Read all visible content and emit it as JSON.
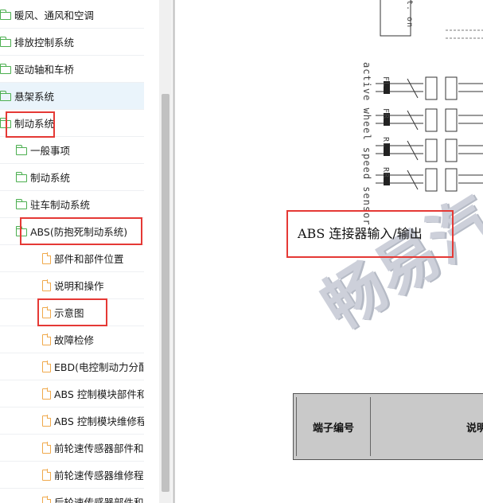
{
  "tree": {
    "items": [
      {
        "label": "暖风、通风和空调",
        "icon": "folder-icon",
        "level": 0
      },
      {
        "label": "排放控制系统",
        "icon": "folder-icon",
        "level": 0
      },
      {
        "label": "驱动轴和车桥",
        "icon": "folder-icon",
        "level": 0
      },
      {
        "label": "悬架系统",
        "icon": "folder-icon",
        "level": 0
      },
      {
        "label": "制动系统",
        "icon": "folder-open-icon",
        "level": 0
      },
      {
        "label": "一般事项",
        "icon": "folder-icon",
        "level": 1
      },
      {
        "label": "制动系统",
        "icon": "folder-icon",
        "level": 1
      },
      {
        "label": "驻车制动系统",
        "icon": "folder-icon",
        "level": 1
      },
      {
        "label": "ABS(防抱死制动系统)",
        "icon": "folder-open-icon",
        "level": 1
      },
      {
        "label": "部件和部件位置",
        "icon": "document-icon",
        "level": 2
      },
      {
        "label": "说明和操作",
        "icon": "document-icon",
        "level": 2
      },
      {
        "label": "示意图",
        "icon": "document-icon",
        "level": 2
      },
      {
        "label": "故障检修",
        "icon": "document-icon",
        "level": 2
      },
      {
        "label": "EBD(电控制动力分配)说",
        "icon": "document-icon",
        "level": 2
      },
      {
        "label": "ABS 控制模块部件和部",
        "icon": "document-icon",
        "level": 2
      },
      {
        "label": "ABS 控制模块维修程序",
        "icon": "document-icon",
        "level": 2
      },
      {
        "label": "前轮速传感器部件和部",
        "icon": "document-icon",
        "level": 2
      },
      {
        "label": "前轮速传感器维修程序",
        "icon": "document-icon",
        "level": 2
      },
      {
        "label": "后轮速传感器部件和部",
        "icon": "document-icon",
        "level": 2
      }
    ]
  },
  "diagram": {
    "sensor_vertical_text": "active wheel speed sensor",
    "wheel_labels": [
      "FL",
      "FR",
      "RL",
      "RR"
    ],
    "top_clip_text": "t.\non",
    "section_title": "ABS 连接器输入/输出",
    "watermark": "畅易汽"
  },
  "table": {
    "headers": [
      "端子编号",
      "说明"
    ]
  },
  "colors": {
    "highlight": "#e53935",
    "folder": "#4caf50",
    "document": "#f0a94b",
    "selected_row": "#eaf4fb",
    "table_header": "#c9c9c9"
  }
}
